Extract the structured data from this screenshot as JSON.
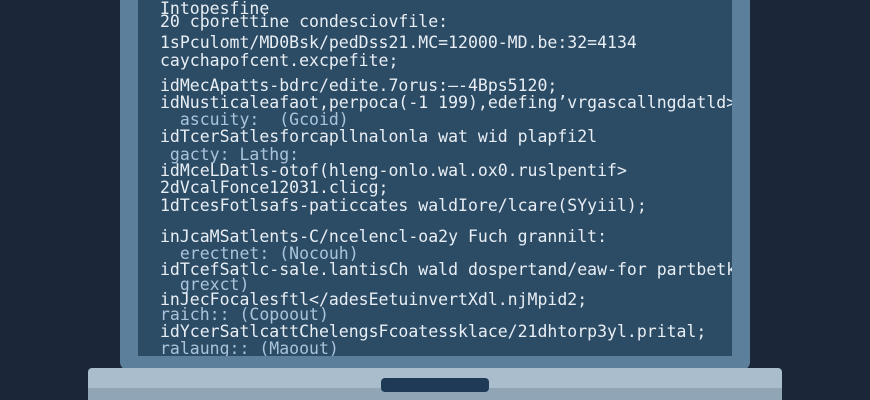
{
  "terminal": {
    "lines": [
      "Intopesfine",
      "20 cporettine condesciovfile:",
      "1sPculomt/MD0Bsk/pedDss21.MC=12000-MD.be:32=4134",
      "caychapofcent.excpefite;",
      "idMecApatts-bdrc/edite.7orus:—-4Bps5120;",
      "idNusticaleafaot,perpoca(-1 199),edefing’vrgascallngdatld>",
      "  ascuity:  (Gcoid)",
      "idTcerSatlesforcapllnalonla wat wid plapfi2l",
      " gacty: Lathg:",
      "idMceLDatls-otof(hleng-onlo.wal.ox0.ruslpentif>",
      "2dVcalFonce12031.clicg;",
      "1dTcesFotlsafs-paticcates waldIore/lcare(SYyiil);",
      "inJcaMSatlents-C/ncelencl-oa2y Fuch grannilt:",
      "  erectnet: (Nocouh)",
      "idTcefSatlc-sale.lantisCh wald dospertand/eaw-for partbetky",
      "  grexct)",
      "inJecFocalesftl</adesEetuinvertXdl.njMpid2;",
      "raich:: (Copoout)",
      "idYcerSatlcattChelengsFcoatessklace/21dhtorp3yl.prital;",
      "ralaung:: (Maoout)"
    ]
  },
  "colors": {
    "background": "#1b2738",
    "screen": "#2c4c66",
    "bezel": "#5c7f9c",
    "text": "#e8eef4",
    "text_dim": "#aac4da",
    "base": "#a9bdcc"
  }
}
